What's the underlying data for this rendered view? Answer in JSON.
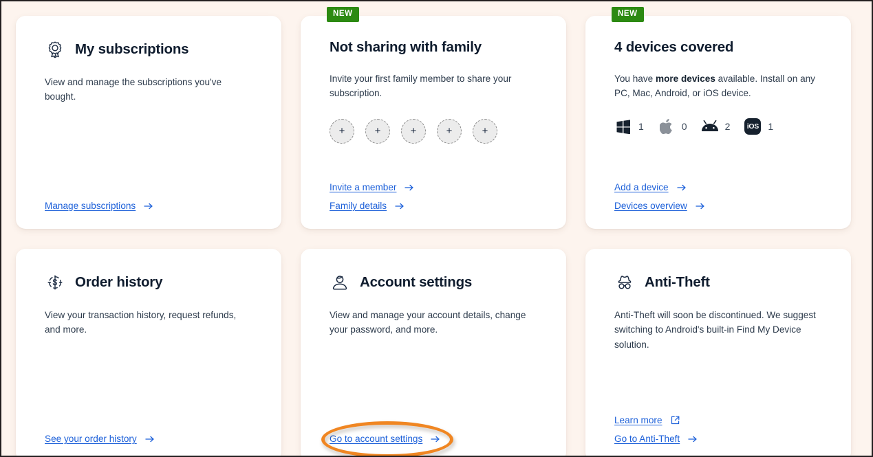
{
  "theme": {
    "page_background": "#fdf4ee",
    "card_background": "#ffffff",
    "link_color": "#1b5fd9",
    "badge_color": "#2c8a12",
    "highlight_color": "#f08622",
    "title_color": "#0f1c2e"
  },
  "cards": [
    {
      "id": "my-subscriptions",
      "icon": "award-ribbon-icon",
      "title": "My subscriptions",
      "description": "View and manage the subscriptions you've bought.",
      "badge": null,
      "links": [
        {
          "label": "Manage subscriptions",
          "icon": "arrow-right-icon"
        }
      ]
    },
    {
      "id": "family-sharing",
      "icon": null,
      "title": "Not sharing with family",
      "description": "Invite your first family member to share your subscription.",
      "badge": "NEW",
      "avatar_slots": [
        "+",
        "+",
        "+",
        "+",
        "+"
      ],
      "links": [
        {
          "label": "Invite a member",
          "icon": "arrow-right-icon"
        },
        {
          "label": "Family details",
          "icon": "arrow-right-icon"
        }
      ]
    },
    {
      "id": "devices-covered",
      "icon": null,
      "title": "4 devices covered",
      "description_parts": [
        {
          "text": "You have ",
          "bold": false
        },
        {
          "text": "more devices",
          "bold": true
        },
        {
          "text": " available. Install on any PC, Mac, Android, or iOS device.",
          "bold": false
        }
      ],
      "badge": "NEW",
      "devices": [
        {
          "icon": "windows-icon",
          "count": "1"
        },
        {
          "icon": "apple-icon",
          "count": "0"
        },
        {
          "icon": "android-icon",
          "count": "2"
        },
        {
          "icon": "ios-icon",
          "label": "iOS",
          "count": "1"
        }
      ],
      "links": [
        {
          "label": "Add a device",
          "icon": "arrow-right-icon"
        },
        {
          "label": "Devices overview",
          "icon": "arrow-right-icon"
        }
      ]
    },
    {
      "id": "order-history",
      "icon": "dollar-refresh-icon",
      "title": "Order history",
      "description": "View your transaction history, request refunds, and more.",
      "badge": null,
      "links": [
        {
          "label": "See your order history",
          "icon": "arrow-right-icon"
        }
      ]
    },
    {
      "id": "account-settings",
      "icon": "user-avatar-icon",
      "title": "Account settings",
      "description": "View and manage your account details, change your password, and more.",
      "badge": null,
      "highlighted_link": true,
      "links": [
        {
          "label": "Go to account settings",
          "icon": "arrow-right-icon"
        }
      ]
    },
    {
      "id": "anti-theft",
      "icon": "incognito-icon",
      "title": "Anti-Theft",
      "description": "Anti-Theft will soon be discontinued. We suggest switching to Android's built-in Find My Device solution.",
      "badge": null,
      "links": [
        {
          "label": "Learn more",
          "icon": "external-link-icon"
        },
        {
          "label": "Go to Anti-Theft",
          "icon": "arrow-right-icon"
        }
      ]
    }
  ]
}
